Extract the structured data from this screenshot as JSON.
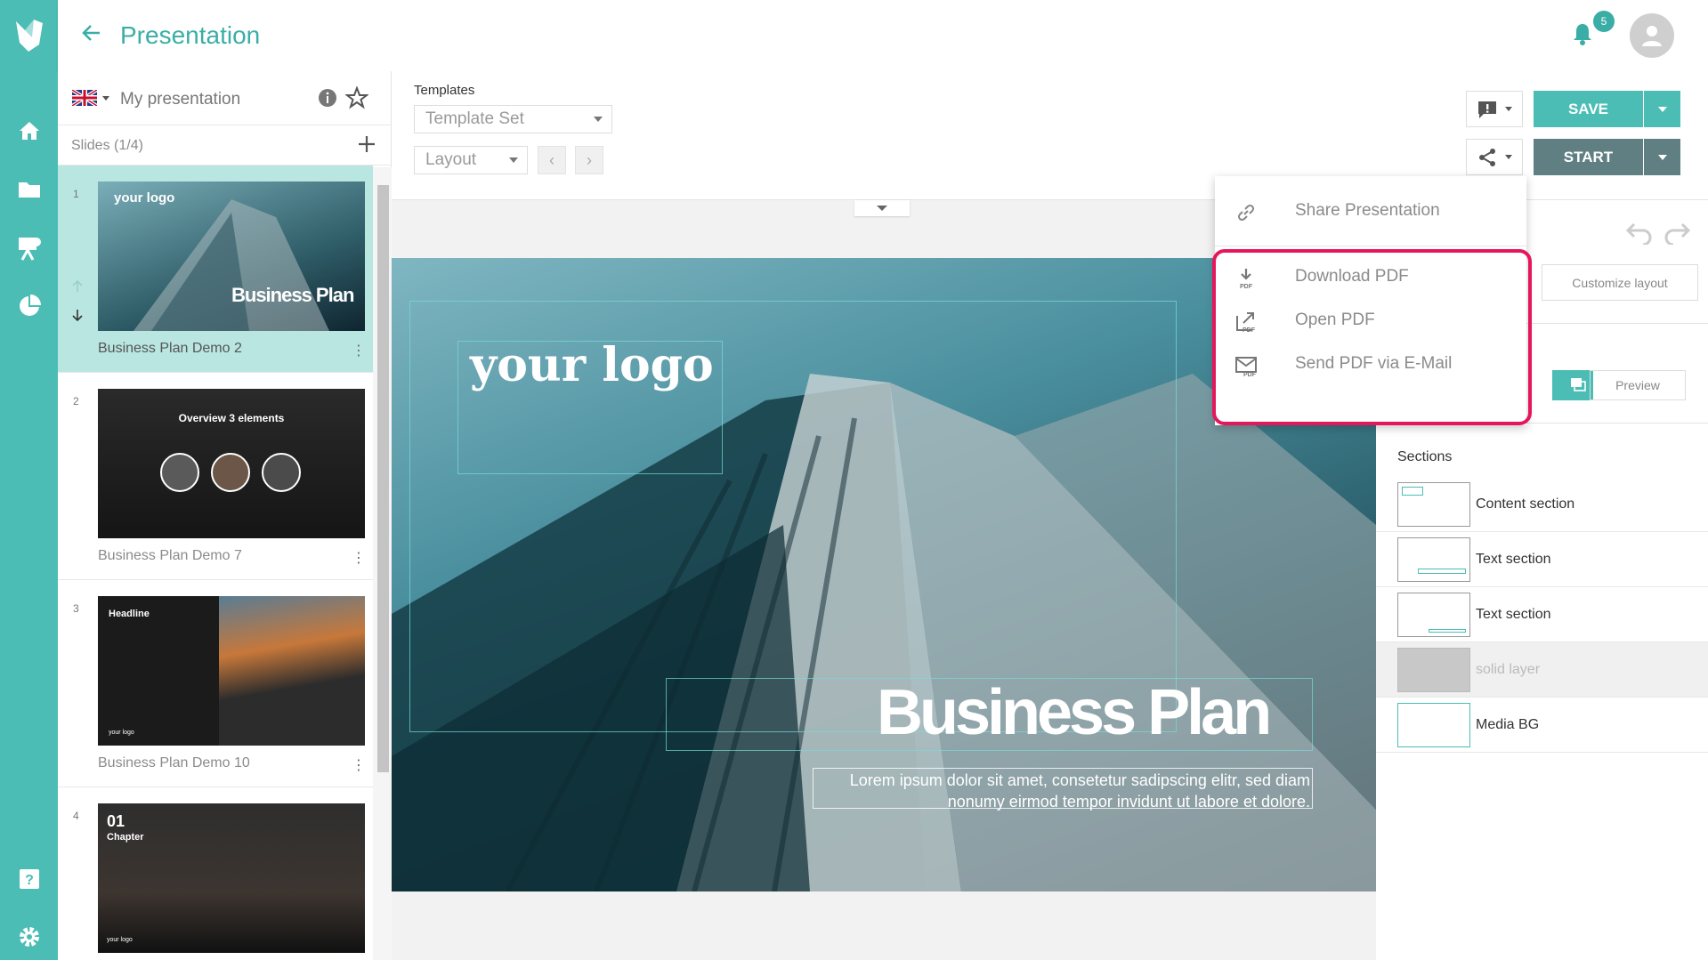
{
  "header": {
    "title": "Presentation",
    "notifications": "5"
  },
  "presentation": {
    "name": "My presentation",
    "language_flag": "uk-flag-icon"
  },
  "slides": {
    "count_label": "Slides (1/4)",
    "items": [
      {
        "num": "1",
        "name": "Business Plan Demo 2",
        "thumb_title": "your logo",
        "thumb_big": "Business Plan"
      },
      {
        "num": "2",
        "name": "Business Plan Demo 7",
        "thumb_title": "Overview 3 elements"
      },
      {
        "num": "3",
        "name": "Business Plan Demo 10",
        "thumb_title": "Headline",
        "thumb_footer": "your logo"
      },
      {
        "num": "4",
        "name": "",
        "thumb_title": "01",
        "thumb_sub": "Chapter",
        "thumb_footer": "your logo"
      }
    ]
  },
  "toolbar": {
    "templates_label": "Templates",
    "template_set": "Template Set",
    "layout": "Layout",
    "save": "SAVE",
    "start": "START",
    "customize_layout": "Customize layout",
    "preview": "Preview"
  },
  "canvas": {
    "logo": "your logo",
    "title": "Business Plan",
    "body": "Lorem ipsum dolor sit amet, consetetur sadipscing elitr, sed diam nonumy eirmod tempor invidunt ut labore et dolore."
  },
  "share_menu": {
    "share": "Share Presentation",
    "download_pdf": "Download PDF",
    "open_pdf": "Open PDF",
    "send_pdf": "Send PDF via E-Mail"
  },
  "sections": {
    "title": "Sections",
    "items": [
      {
        "label": "Content section"
      },
      {
        "label": "Text section"
      },
      {
        "label": "Text section"
      },
      {
        "label": "solid layer"
      },
      {
        "label": "Media BG"
      }
    ]
  },
  "colors": {
    "accent": "#4bbdb5",
    "highlight": "#e5175b",
    "start": "#5f7f82"
  }
}
